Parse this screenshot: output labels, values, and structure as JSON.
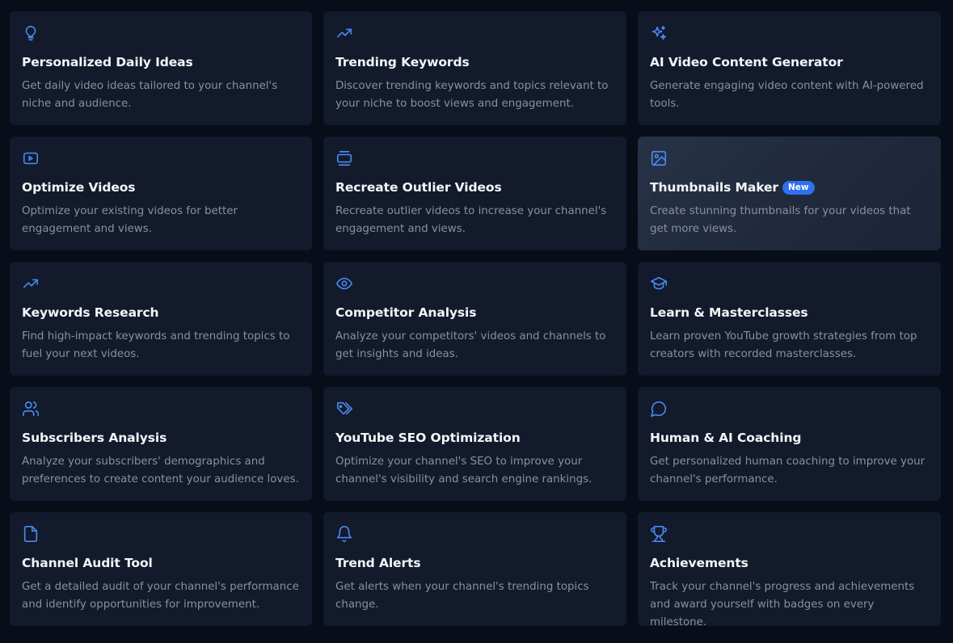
{
  "colors": {
    "background": "#080d1a",
    "card": "#121a2b",
    "accent_icon": "#4a88f0",
    "badge": "#2f6ff0"
  },
  "cards": [
    {
      "icon": "lightbulb-icon",
      "title": "Personalized Daily Ideas",
      "desc": "Get daily video ideas tailored to your channel's niche and audience."
    },
    {
      "icon": "trending-up-icon",
      "title": "Trending Keywords",
      "desc": "Discover trending keywords and topics relevant to your niche to boost views and engagement."
    },
    {
      "icon": "sparkles-icon",
      "title": "AI Video Content Generator",
      "desc": "Generate engaging video content with AI-powered tools."
    },
    {
      "icon": "video-play-icon",
      "title": "Optimize Videos",
      "desc": "Optimize your existing videos for better engagement and views."
    },
    {
      "icon": "stack-icon",
      "title": "Recreate Outlier Videos",
      "desc": "Recreate outlier videos to increase your channel's engagement and views."
    },
    {
      "icon": "image-icon",
      "title": "Thumbnails Maker",
      "badge": "New",
      "desc": "Create stunning thumbnails for your videos that get more views."
    },
    {
      "icon": "trending-up-icon",
      "title": "Keywords Research",
      "desc": "Find high-impact keywords and trending topics to fuel your next videos."
    },
    {
      "icon": "eye-icon",
      "title": "Competitor Analysis",
      "desc": "Analyze your competitors' videos and channels to get insights and ideas."
    },
    {
      "icon": "graduation-cap-icon",
      "title": "Learn & Masterclasses",
      "desc": "Learn proven YouTube growth strategies from top creators with recorded masterclasses."
    },
    {
      "icon": "users-icon",
      "title": "Subscribers Analysis",
      "desc": "Analyze your subscribers' demographics and preferences to create content your audience loves."
    },
    {
      "icon": "tags-icon",
      "title": "YouTube SEO Optimization",
      "desc": "Optimize your channel's SEO to improve your channel's visibility and search engine rankings."
    },
    {
      "icon": "chat-bubble-icon",
      "title": "Human & AI Coaching",
      "desc": "Get personalized human coaching to improve your channel's performance."
    },
    {
      "icon": "file-icon",
      "title": "Channel Audit Tool",
      "desc": "Get a detailed audit of your channel's performance and identify opportunities for improvement."
    },
    {
      "icon": "bell-icon",
      "title": "Trend Alerts",
      "desc": "Get alerts when your channel's trending topics change."
    },
    {
      "icon": "trophy-icon",
      "title": "Achievements",
      "desc": "Track your channel's progress and achievements and award yourself with badges on every milestone."
    }
  ]
}
